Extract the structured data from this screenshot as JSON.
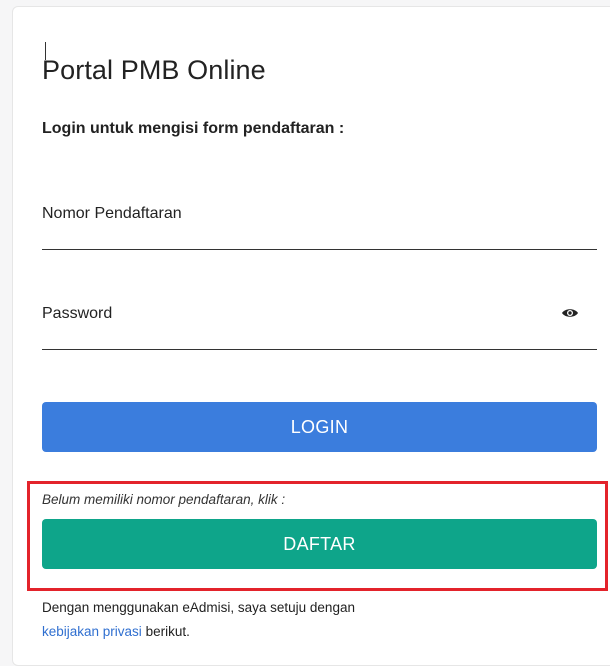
{
  "form": {
    "title": "Portal PMB Online",
    "subtitle": "Login untuk mengisi form pendaftaran :",
    "registration_number": {
      "placeholder": "Nomor Pendaftaran",
      "value": ""
    },
    "password": {
      "placeholder": "Password",
      "value": ""
    },
    "login_label": "LOGIN",
    "register_hint": "Belum memiliki nomor pendaftaran, klik :",
    "register_label": "DAFTAR",
    "consent_prefix": "Dengan menggunakan eAdmisi, saya setuju dengan",
    "privacy_link": "kebijakan privasi",
    "consent_suffix": " berikut."
  },
  "icons": {
    "password_toggle": "eye-icon"
  },
  "colors": {
    "login_button": "#3b7ddd",
    "register_button": "#0ea58a",
    "highlight_border": "#e3232b",
    "link": "#2f6fd0"
  }
}
